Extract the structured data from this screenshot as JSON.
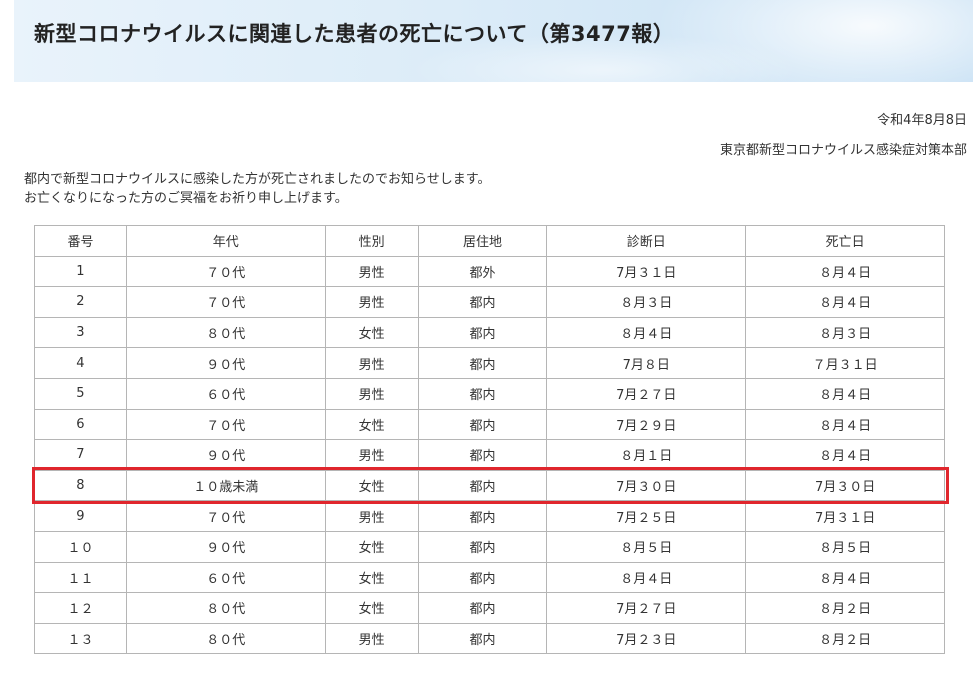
{
  "header": {
    "title": "新型コロナウイルスに関連した患者の死亡について（第3477報）"
  },
  "meta": {
    "date": "令和4年8月8日",
    "organization": "東京都新型コロナウイルス感染症対策本部"
  },
  "intro": {
    "line1": "都内で新型コロナウイルスに感染した方が死亡されましたのでお知らせします。",
    "line2": "お亡くなりになった方のご冥福をお祈り申し上げます。"
  },
  "table": {
    "headers": [
      "番号",
      "年代",
      "性別",
      "居住地",
      "診断日",
      "死亡日"
    ],
    "rows": [
      [
        "1",
        "７０代",
        "男性",
        "都外",
        "7月３１日",
        "８月４日"
      ],
      [
        "2",
        "７０代",
        "男性",
        "都内",
        "８月３日",
        "８月４日"
      ],
      [
        "3",
        "８０代",
        "女性",
        "都内",
        "８月４日",
        "８月３日"
      ],
      [
        "4",
        "９０代",
        "男性",
        "都内",
        "7月８日",
        "７月３１日"
      ],
      [
        "5",
        "６０代",
        "男性",
        "都内",
        "7月２７日",
        "８月４日"
      ],
      [
        "6",
        "７０代",
        "女性",
        "都内",
        "7月２９日",
        "８月４日"
      ],
      [
        "7",
        "９０代",
        "男性",
        "都内",
        "８月１日",
        "８月４日"
      ],
      [
        "8",
        "１０歳未満",
        "女性",
        "都内",
        "7月３０日",
        "7月３０日"
      ],
      [
        "9",
        "７０代",
        "男性",
        "都内",
        "7月２５日",
        "7月３１日"
      ],
      [
        "１０",
        "９０代",
        "女性",
        "都内",
        "８月５日",
        "８月５日"
      ],
      [
        "１１",
        "６０代",
        "女性",
        "都内",
        "８月４日",
        "８月４日"
      ],
      [
        "１２",
        "８０代",
        "女性",
        "都内",
        "7月２７日",
        "８月２日"
      ],
      [
        "１３",
        "８０代",
        "男性",
        "都内",
        "7月２３日",
        "８月２日"
      ]
    ],
    "highlight_row": 8,
    "highlight_color": "#e0262d"
  }
}
